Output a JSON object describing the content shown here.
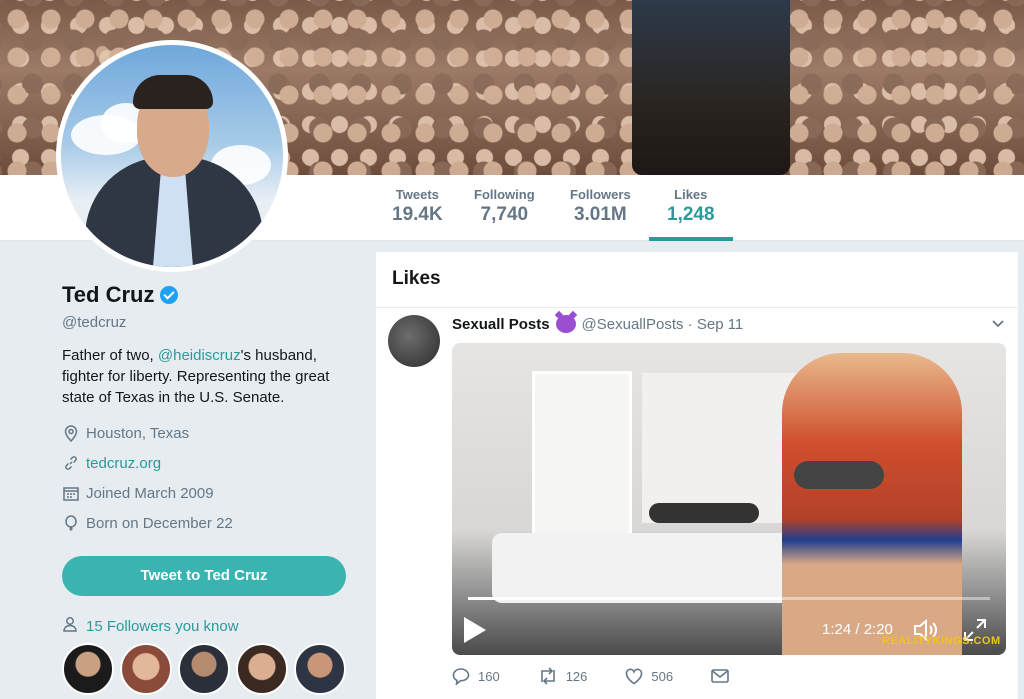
{
  "profile": {
    "name": "Ted Cruz",
    "handle": "@tedcruz",
    "bio_prefix": "Father of two, ",
    "bio_mention": "@heidiscruz",
    "bio_suffix": "'s husband, fighter for liberty. Representing the great state of Texas in the U.S. Senate.",
    "location": "Houston, Texas",
    "website": "tedcruz.org",
    "joined": "Joined March 2009",
    "born": "Born on December 22",
    "tweet_to_label": "Tweet to Ted Cruz",
    "followers_you_know": "15 Followers you know"
  },
  "stats": [
    {
      "label": "Tweets",
      "value": "19.4K"
    },
    {
      "label": "Following",
      "value": "7,740"
    },
    {
      "label": "Followers",
      "value": "3.01M"
    },
    {
      "label": "Likes",
      "value": "1,248"
    }
  ],
  "likes_header": "Likes",
  "tweet": {
    "display_name": "Sexuall Posts",
    "handle": "@SexuallPosts",
    "date": "Sep 11",
    "video_time": "1:24 / 2:20",
    "video_progress": 0.6,
    "watermark": "REALITYKINGS.COM",
    "replies": "160",
    "retweets": "126",
    "likes": "506"
  },
  "colors": {
    "accent": "#2b9a9b",
    "button": "#3ab4b0",
    "background": "#e6ecf0"
  }
}
